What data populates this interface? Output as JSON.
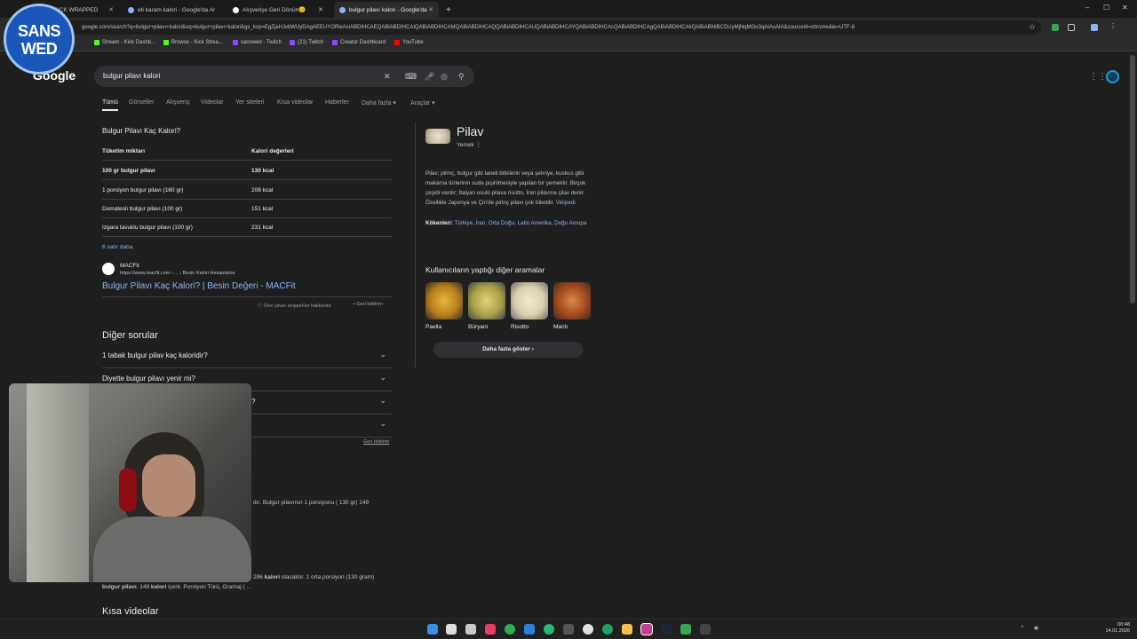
{
  "tabs": [
    {
      "label": "EL - KICK WRAPPED"
    },
    {
      "label": "eti karam kalori - Google'da Ar"
    },
    {
      "label": "Alışverişe Geri Dönün😊"
    },
    {
      "label": "bulgur pilavı kalori - Google'da"
    }
  ],
  "url": "google.com/search?q=bulgur+pilavı+kalori&oq=bulgur+pilavı+kalori&gs_lcrp=EgZjaHJvbWUyDAgAEEUYORixAxiABDIHCAEQABiABDIHCAIQABiABDIHCAMQABiABDIHCAQQABiABDIHCAUQABiABDIHCAYQABiABDIHCAcQABiABDIHCAgQABiABDIHCAkQABiABNIBCDUyMjNqMGo3qAIAsAIA&sourceid=chrome&ie=UTF-8",
  "bookmarks": [
    "Stream - Kick Dashb...",
    "Browse - Kick Strea...",
    "sanswed - Twitch",
    "(21) Twitch",
    "Creator Dashboard",
    "YouTube"
  ],
  "overlay_logo": {
    "line1": "SANS",
    "line2": "WED"
  },
  "google": {
    "logo": "Google",
    "query": "bulgur pilavı kalori"
  },
  "nav": [
    "Tümü",
    "Görseller",
    "Alışveriş",
    "Videolar",
    "Yer siteleri",
    "Kısa videolar",
    "Haberler",
    "Daha fazla",
    "Araçlar"
  ],
  "snippet": {
    "title": "Bulgur Pilavı Kaç Kalori?",
    "headers": [
      "Tüketim miktarı",
      "Kalori değerleri"
    ],
    "rows": [
      [
        "100 gr bulgur pilavı",
        "130 kcal"
      ],
      [
        "1 porsiyon bulgur pilavı (160 gr)",
        "208 kcal"
      ],
      [
        "Domatesli bulgur pilavı (100 gr)",
        "151 kcal"
      ],
      [
        "Izgara tavuklu bulgur pilavı (100 gr)",
        "231 kcal"
      ]
    ],
    "more": "6 satır daha",
    "source_name": "MACFit",
    "source_url": "https://www.macfit.com › ... › Besin Kalori Hesaplama",
    "source_title": "Bulgur Pilavı Kaç Kalori? | Besin Değeri - MACFit",
    "about": "Öne çıkan snippet'ler hakkında",
    "feedback": "Geri bildirim"
  },
  "paa": {
    "title": "Diğer sorular",
    "questions": [
      "1 tabak bulgur pilav kaç kaloridir?",
      "Diyette bulgur pilavı yenir mi?",
      "?",
      ""
    ],
    "feedback": "Geri bildirim"
  },
  "lower": {
    "frag1": "dır. Bulgur pilavının 1 porsiyonu ( 130 gr) 149",
    "frag2a": "286 ",
    "frag2b": "kalori",
    "frag2c": " olacaktır. 1 orta porsiyon (130 gram)",
    "frag3a": "bulgur pilavı",
    "frag3b": ". 149 ",
    "frag3c": "kalori",
    "frag3d": " içerir. Porsiyon Türü, Gramaj ( ...",
    "short_videos": "Kısa videolar"
  },
  "kg": {
    "title": "Pilav",
    "subtitle": "Yemek",
    "desc": "Pilav; pirinç, bulgur gibi taneli bitkilerin veya şehriye, kuskus gibi makarna türlerinin suda pişirilmesiyle yapılan bir yemektir. Birçok çeşidi vardır; İtalyan usulü pilava risotto, İran pilavına çilav denir. Özellikle Japonya ve Çin'de pirinç pilavı çok tüketilir.",
    "wiki": "Vikipedi",
    "origin_label": "Kökenleri:",
    "origin": "Türkiye, İran, Orta Doğu, Latin Amerika, Doğu Avrupa",
    "related_title": "Kullanıcıların yaptığı diğer aramalar",
    "related": [
      "Paella",
      "Büryani",
      "Risotto",
      "Mantı"
    ],
    "show_more": "Daha fazla göster"
  },
  "clock": {
    "time": "00:48",
    "date": "14.01.2026"
  }
}
